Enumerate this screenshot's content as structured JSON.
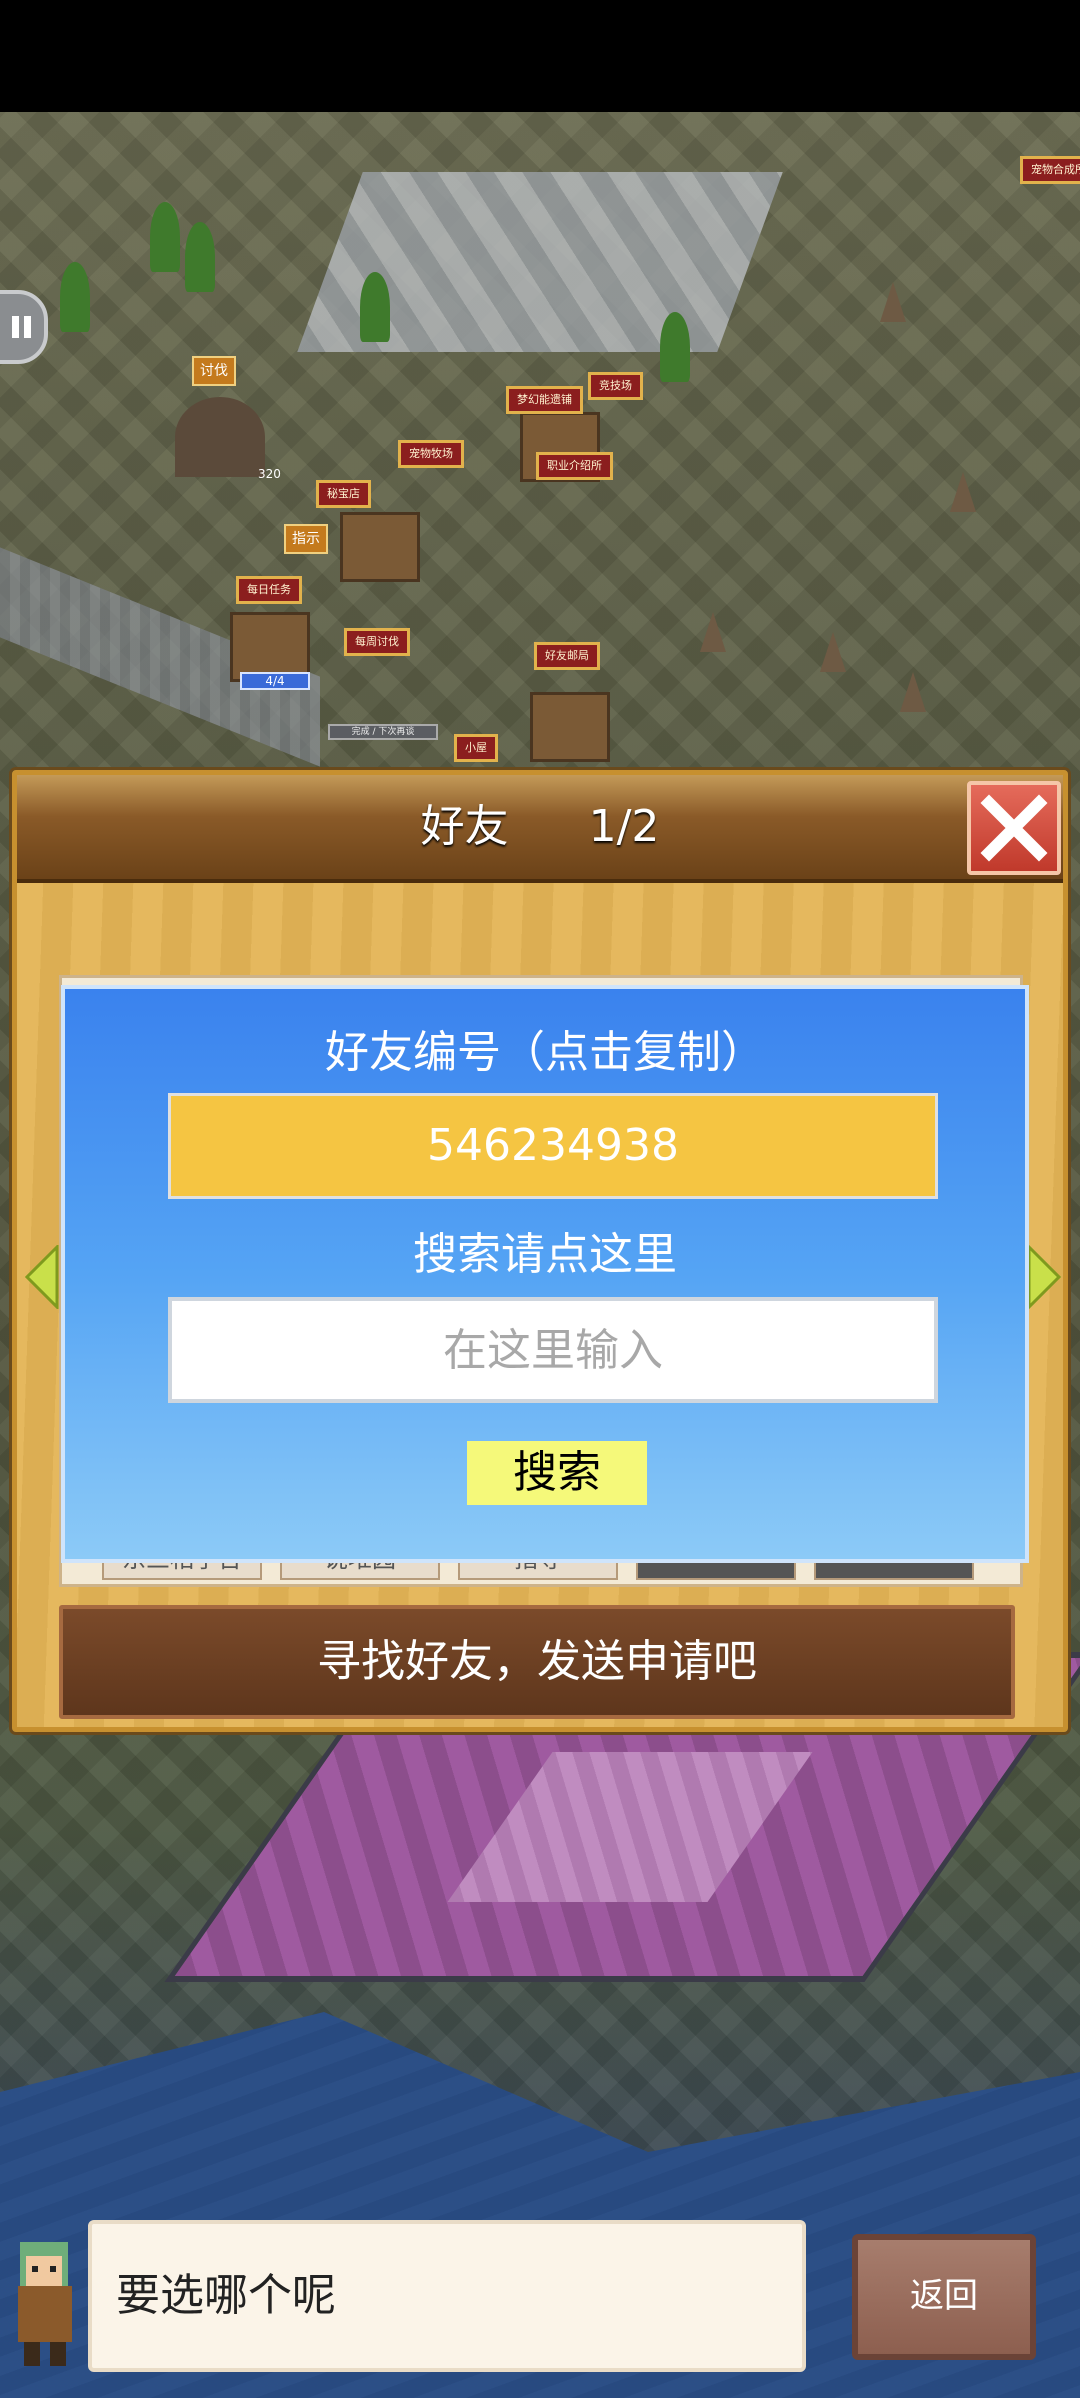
{
  "map": {
    "labels": [
      "讨伐",
      "梦幻能遗铺",
      "竞技场",
      "宠物牧场",
      "职业介绍所",
      "秘宝店",
      "每日任务",
      "每周讨伐",
      "好友邮局",
      "小屋",
      "宠物合成所",
      "指示"
    ],
    "counter": "320",
    "blue_bar": "4/4",
    "gray_bar": "完成 / 下次再谈"
  },
  "dialog": {
    "title": "好友",
    "page": "1/2",
    "friend_id_label": "好友编号（点击复制）",
    "friend_id": "546234938",
    "search_label": "搜索请点这里",
    "search_placeholder": "在这里输入",
    "search_button": "搜索",
    "find_banner": "寻找好友，发送申请吧",
    "bg_slots": [
      "东三相学台",
      "说堆园",
      "指导"
    ]
  },
  "message": {
    "text": "要选哪个呢",
    "back_button": "返回"
  },
  "icons": {
    "close": "close-icon",
    "arrow_left": "arrow-left-icon",
    "arrow_right": "arrow-right-icon",
    "pause": "pause-icon"
  },
  "colors": {
    "overlay_blue": "#3a82ee",
    "id_yellow": "#f5c542",
    "close_red": "#c0392b",
    "banner_brown": "#6b4218"
  }
}
